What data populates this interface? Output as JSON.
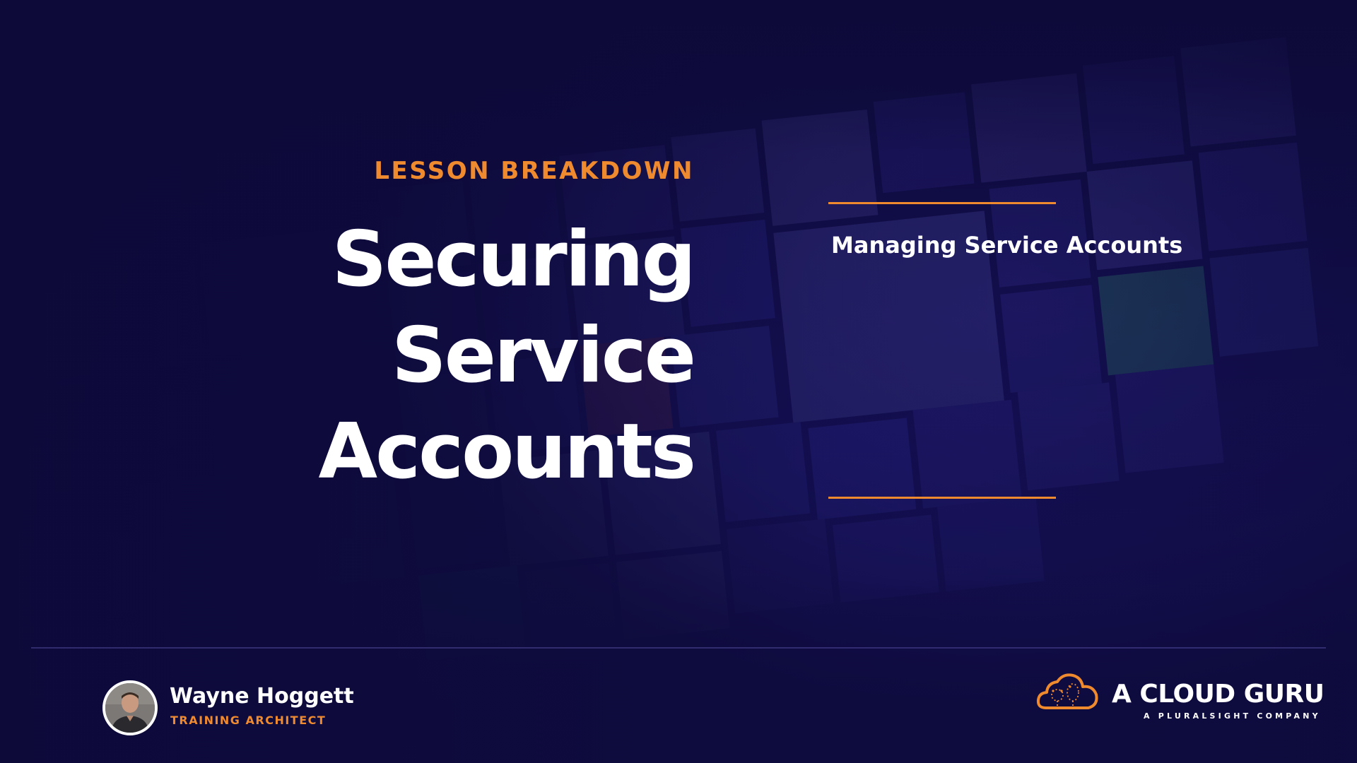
{
  "slide": {
    "eyebrow": "LESSON BREAKDOWN",
    "title_lines": [
      "Securing",
      "Service",
      "Accounts"
    ],
    "topics": [
      "Managing Service Accounts"
    ]
  },
  "presenter": {
    "name": "Wayne Hoggett",
    "role": "TRAINING ARCHITECT",
    "avatar_icon": "presenter-photo"
  },
  "brand": {
    "name": "A CLOUD GURU",
    "tagline": "A PLURALSIGHT COMPANY",
    "logo_icon": "cloud-logo-icon"
  },
  "colors": {
    "background": "#120d45",
    "accent": "#f08a2f",
    "text": "#ffffff"
  }
}
